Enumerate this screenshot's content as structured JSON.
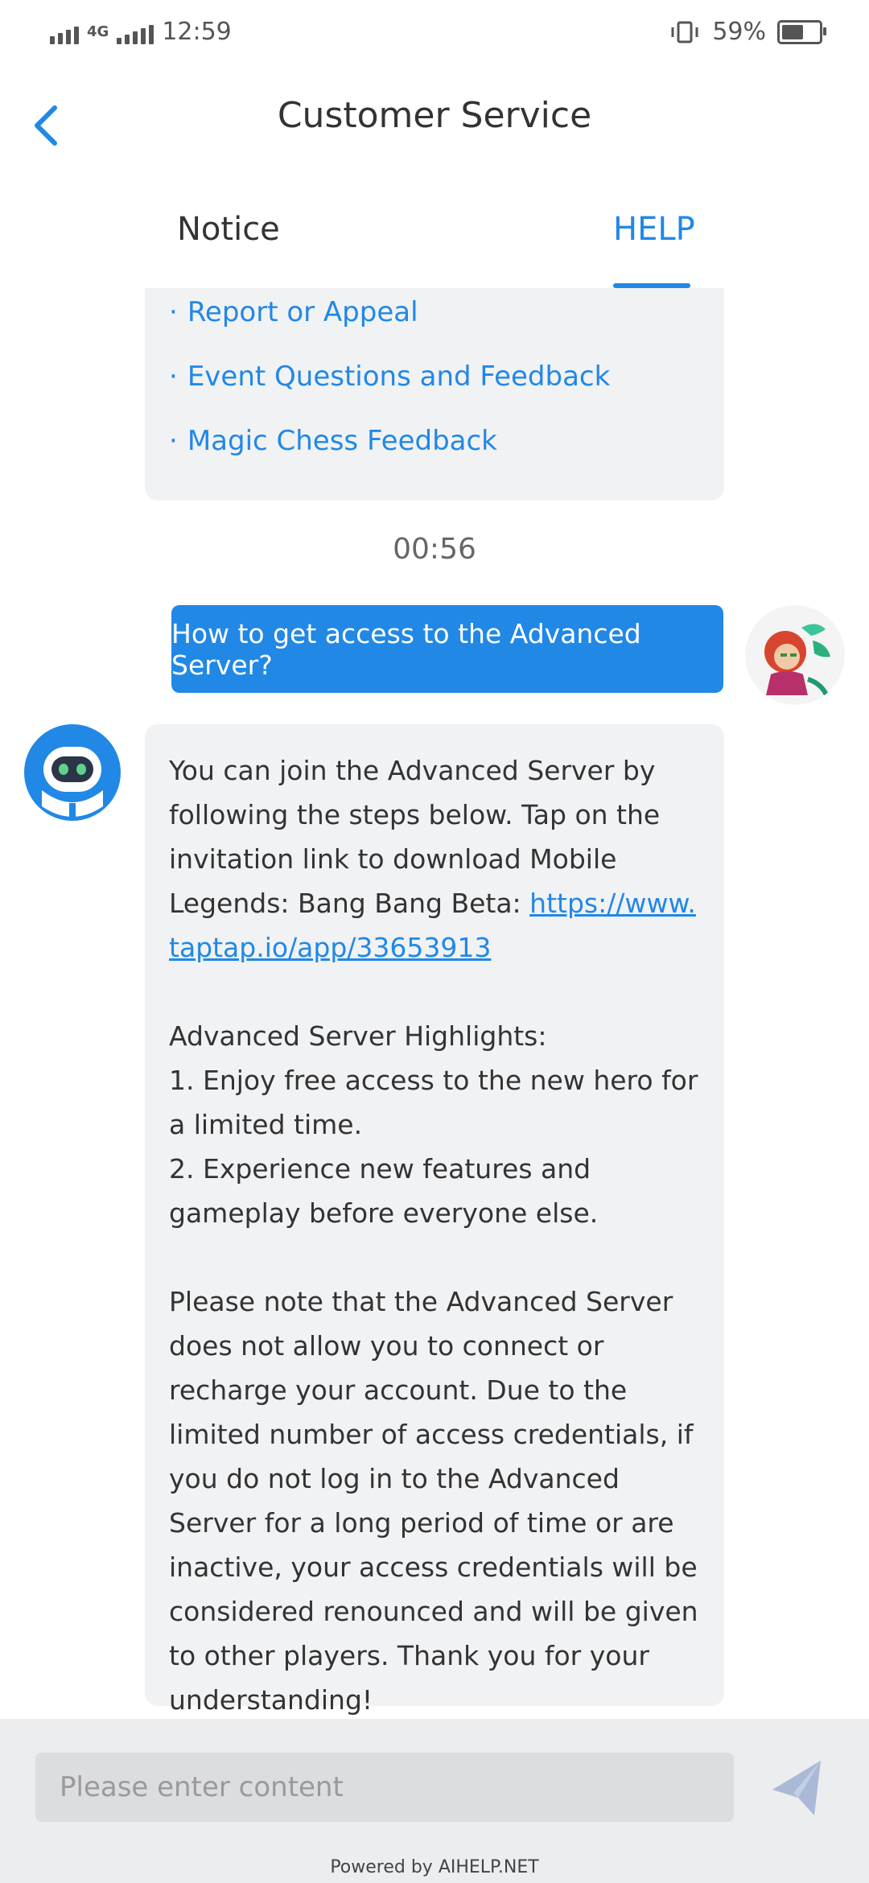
{
  "status_bar": {
    "network": "4G",
    "time": "12:59",
    "battery_percent": "59%",
    "battery_level": 0.59
  },
  "header": {
    "title": "Customer Service"
  },
  "tabs": [
    {
      "label": "Notice",
      "active": false
    },
    {
      "label": "HELP",
      "active": true
    }
  ],
  "menu": {
    "items": [
      "Report or Appeal",
      "Event Questions and Feedback",
      "Magic Chess Feedback"
    ]
  },
  "chat": {
    "timestamp": "00:56",
    "user_message": "How to get access to the Advanced Server?",
    "bot_message": {
      "intro": "You can join the Advanced Server by following the steps below. Tap on the invitation link to download Mobile Legends: Bang Bang Beta: ",
      "link": "https://www.taptap.io/app/33653913",
      "highlights_title": "Advanced Server Highlights:",
      "highlight_1": "1. Enjoy free access to the new hero for a limited time.",
      "highlight_2": "2. Experience new features and gameplay before everyone else.",
      "note": "Please note that the Advanced Server does not allow you to connect or recharge your account. Due to the limited number of access credentials, if you do not log in to the Advanced Server for a long period of time or are inactive, your access credentials will be considered renounced and will be given to other players. Thank you for your understanding!"
    }
  },
  "footer": {
    "input_placeholder": "Please enter content",
    "powered_by": "Powered by AIHELP.NET"
  },
  "colors": {
    "accent": "#2188e6",
    "bubble_bg": "#f1f2f4",
    "footer_bg": "#ecedef"
  }
}
